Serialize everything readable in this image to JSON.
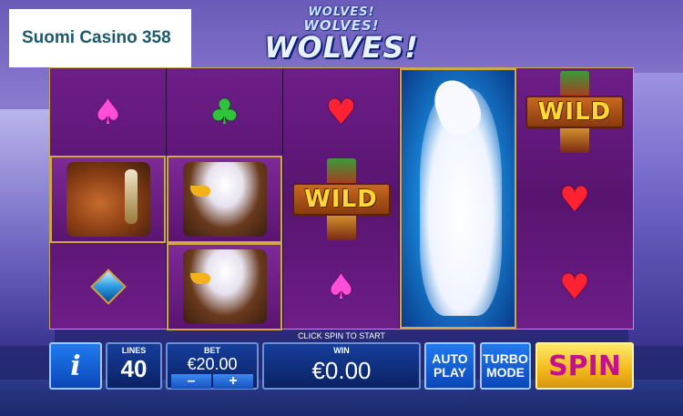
{
  "brand": {
    "text": "Suomi Casino 358"
  },
  "game": {
    "logo_small_1": "WOLVES!",
    "logo_small_2": "WOLVES!",
    "logo_main": "WOLVES!"
  },
  "reels": {
    "wild_label": "WILD",
    "columns": [
      [
        "spade",
        "horse",
        "diamond"
      ],
      [
        "club",
        "eagle",
        "eagle"
      ],
      [
        "heart",
        "wild",
        "spade"
      ],
      [
        "wolf-stacked"
      ],
      [
        "wild",
        "heart",
        "heart"
      ]
    ]
  },
  "status": {
    "message": "CLICK SPIN TO START"
  },
  "hud": {
    "info_label": "i",
    "lines_label": "LINES",
    "lines_value": "40",
    "bet_label": "BET",
    "bet_value": "€20.00",
    "bet_minus": "–",
    "bet_plus": "+",
    "win_label": "WIN",
    "win_value": "€0.00",
    "autoplay_line1": "AUTO",
    "autoplay_line2": "PLAY",
    "turbo_line1": "TURBO",
    "turbo_line2": "MODE",
    "spin_label": "SPIN"
  },
  "colors": {
    "spin_button": "#f2b81a",
    "spin_text": "#c2128c",
    "panel_blue": "#163e9a",
    "reel_purple": "#6d1e88",
    "frame_gold": "#d0a84a"
  }
}
